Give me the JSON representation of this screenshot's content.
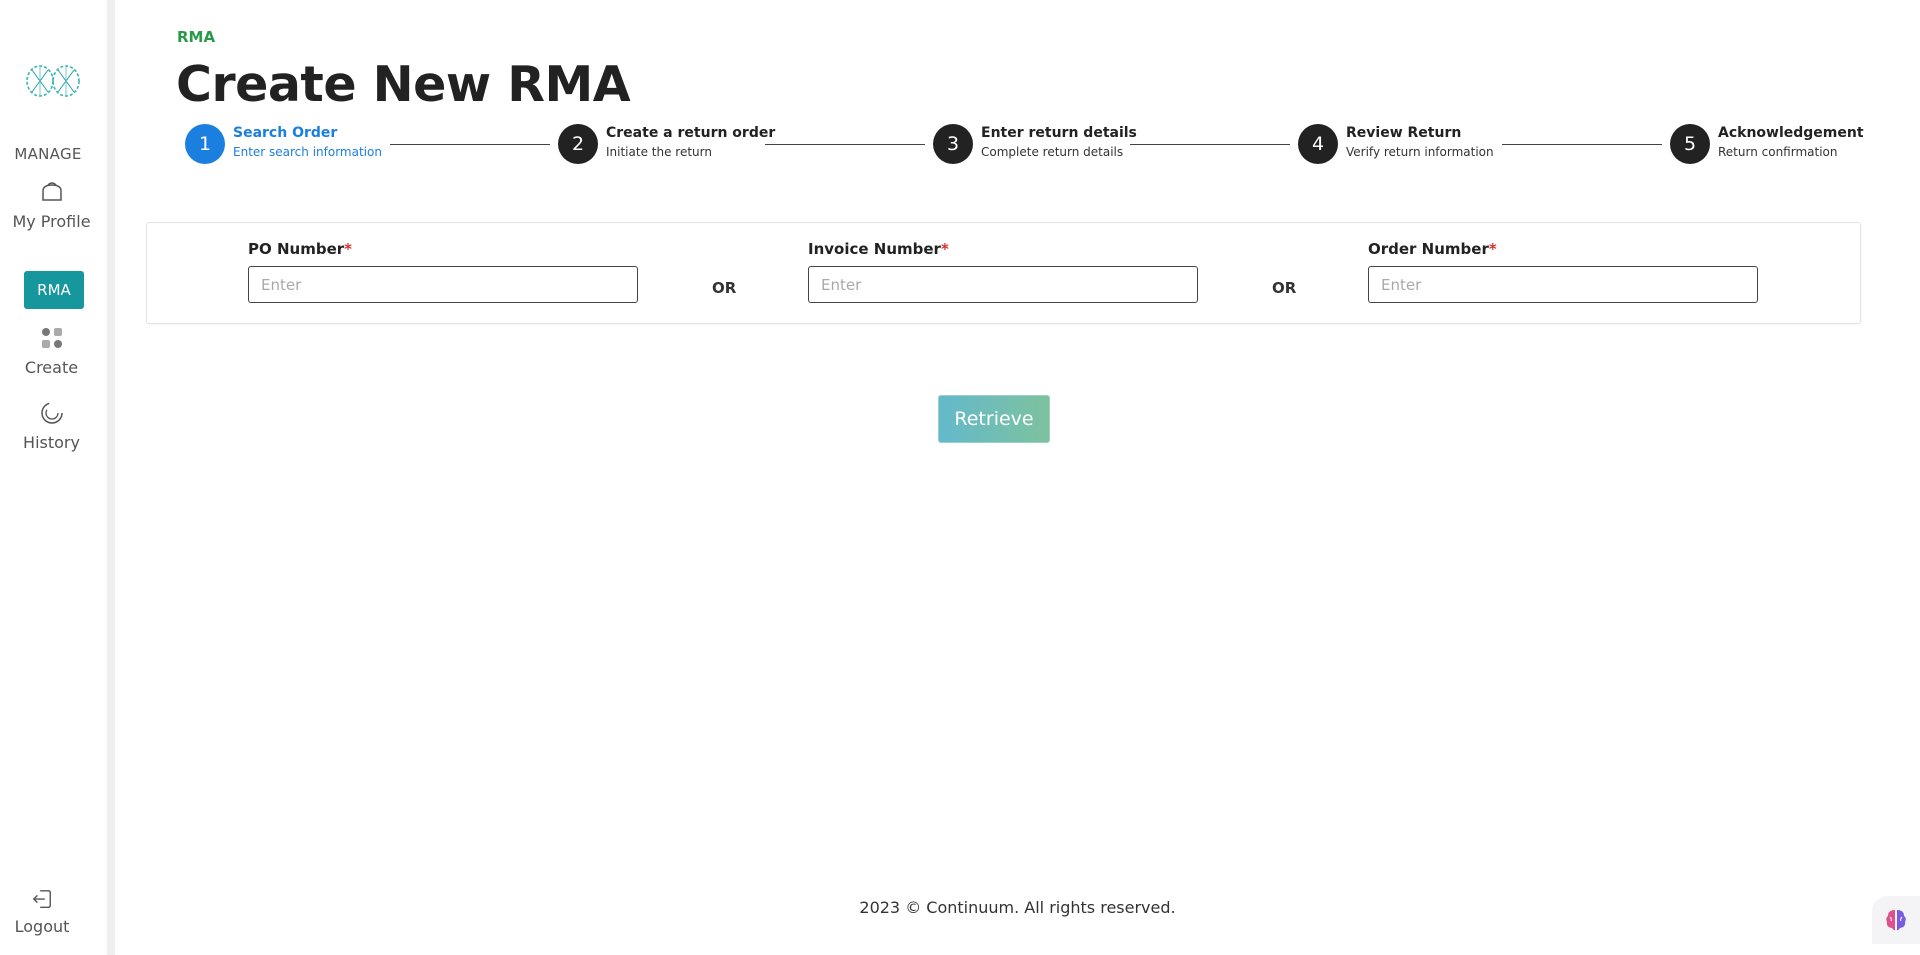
{
  "sidebar": {
    "manage_label": "MANAGE",
    "my_profile_label": "My Profile",
    "rma_label": "RMA",
    "create_label": "Create",
    "history_label": "History",
    "logout_label": "Logout",
    "accent_color": "#16969d"
  },
  "header": {
    "breadcrumb": "RMA",
    "title": "Create New RMA"
  },
  "stepper": {
    "steps": [
      {
        "number": "1",
        "title": "Search Order",
        "subtitle": "Enter search information",
        "state": "active"
      },
      {
        "number": "2",
        "title": "Create a return order",
        "subtitle": "Initiate the return",
        "state": "pending"
      },
      {
        "number": "3",
        "title": "Enter return details",
        "subtitle": "Complete return details",
        "state": "pending"
      },
      {
        "number": "4",
        "title": "Review Return",
        "subtitle": "Verify return information",
        "state": "pending"
      },
      {
        "number": "5",
        "title": "Acknowledgement",
        "subtitle": "Return confirmation",
        "state": "pending"
      }
    ],
    "active_color": "#1b7fe0"
  },
  "search": {
    "po_label": "PO Number",
    "po_placeholder": "Enter",
    "po_value": "",
    "invoice_label": "Invoice Number",
    "invoice_placeholder": "Enter",
    "invoice_value": "",
    "order_label": "Order Number",
    "order_placeholder": "Enter",
    "order_value": "",
    "required_mark": "*",
    "or_text": "OR"
  },
  "actions": {
    "retrieve_label": "Retrieve"
  },
  "footer": {
    "text": "2023 © Continuum. All rights reserved."
  },
  "icons": {
    "logo": "continuum-logo-icon",
    "my_profile": "bag-icon",
    "create": "grid-icon",
    "history": "history-icon",
    "logout": "logout-icon",
    "assistant": "brain-icon"
  }
}
